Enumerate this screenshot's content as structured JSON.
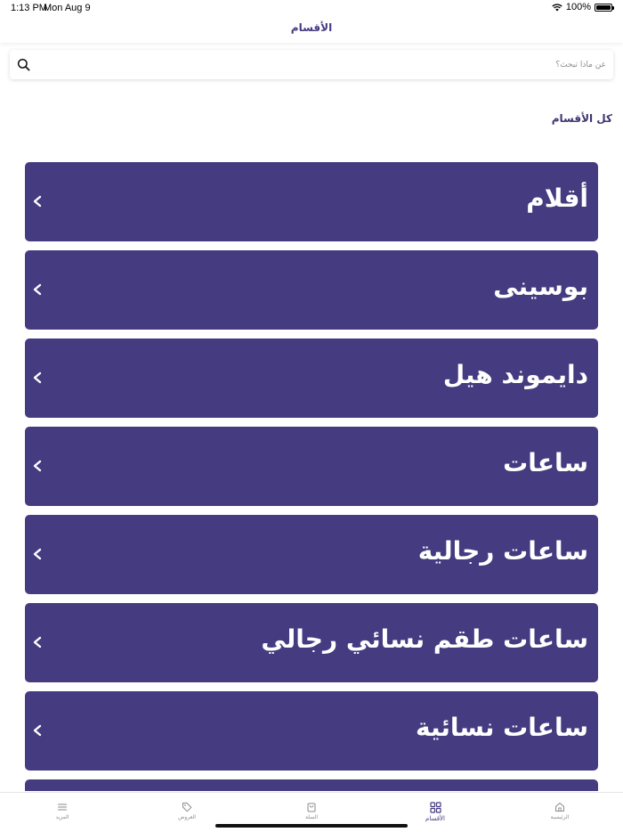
{
  "status_bar": {
    "time": "1:13 PM",
    "date": "Mon Aug 9",
    "battery": "100%"
  },
  "nav": {
    "title": "الأقسام"
  },
  "search": {
    "placeholder": "عن ماذا تبحث؟"
  },
  "section": {
    "title": "كل الأقسام"
  },
  "categories": [
    {
      "label": "أقلام"
    },
    {
      "label": "بوسينى"
    },
    {
      "label": "دايموند هيل"
    },
    {
      "label": "ساعات"
    },
    {
      "label": "ساعات رجالية"
    },
    {
      "label": "ساعات طقم نسائي رجالي"
    },
    {
      "label": "ساعات نسائية"
    },
    {
      "label": ""
    }
  ],
  "tabs": [
    {
      "label": "المزيد",
      "icon": "menu-icon",
      "active": false
    },
    {
      "label": "العروض",
      "icon": "tag-icon",
      "active": false
    },
    {
      "label": "السلة",
      "icon": "shopping-bag-icon",
      "active": false
    },
    {
      "label": "الأقسام",
      "icon": "grid-icon",
      "active": true
    },
    {
      "label": "الرئيسية",
      "icon": "home-icon",
      "active": false
    }
  ],
  "colors": {
    "accent": "#453b80",
    "title": "#443b7f",
    "inactive": "#8a8a8a"
  }
}
